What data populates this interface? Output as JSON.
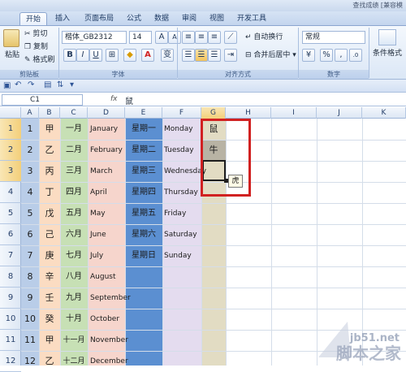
{
  "window": {
    "title": "查找成绩 [兼容模"
  },
  "tabs": [
    "开始",
    "插入",
    "页面布局",
    "公式",
    "数据",
    "审阅",
    "视图",
    "开发工具"
  ],
  "ribbon": {
    "clipboard": {
      "paste": "粘贴",
      "cut": "剪切",
      "copy": "复制",
      "format_painter": "格式刷",
      "label": "剪贴板"
    },
    "font": {
      "name": "楷体_GB2312",
      "size": "14",
      "bold": "B",
      "italic": "I",
      "underline": "U",
      "label": "字体",
      "wen": "变"
    },
    "alignment": {
      "wrap": "自动换行",
      "merge": "合并后居中",
      "label": "对齐方式"
    },
    "number": {
      "format": "常规",
      "percent": "%",
      "comma": ",",
      "label": "数字"
    },
    "styles": {
      "conditional": "条件格式"
    }
  },
  "formula_bar": {
    "name_box": "C1",
    "fx": "fx",
    "content": "鼠"
  },
  "columns": [
    "A",
    "B",
    "C",
    "D",
    "E",
    "F",
    "G",
    "H",
    "I",
    "J",
    "K"
  ],
  "rows": [
    "1",
    "2",
    "3",
    "4",
    "5",
    "6",
    "7",
    "8",
    "9",
    "10",
    "11",
    "12"
  ],
  "col_A": [
    "1",
    "2",
    "3",
    "4",
    "5",
    "6",
    "7",
    "8",
    "9",
    "10",
    "11",
    "12"
  ],
  "col_B": [
    "甲",
    "乙",
    "丙",
    "丁",
    "戊",
    "己",
    "庚",
    "辛",
    "壬",
    "癸",
    "甲",
    "乙"
  ],
  "col_C": [
    "一月",
    "二月",
    "三月",
    "四月",
    "五月",
    "六月",
    "七月",
    "八月",
    "九月",
    "十月",
    "十一月",
    "十二月"
  ],
  "col_D": [
    "January",
    "February",
    "March",
    "April",
    "May",
    "June",
    "July",
    "August",
    "September",
    "October",
    "November",
    "December"
  ],
  "col_E": [
    "星期一",
    "星期二",
    "星期三",
    "星期四",
    "星期五",
    "星期六",
    "星期日"
  ],
  "col_F": [
    "Monday",
    "Tuesday",
    "Wednesday",
    "Thursday",
    "Friday",
    "Saturday",
    "Sunday"
  ],
  "col_G": [
    "鼠",
    "牛"
  ],
  "autofill_tip": "虎",
  "watermark": {
    "url": "jb51.net",
    "cn": "脚本之家"
  },
  "colors": {
    "col_a": "#b9cde8",
    "col_b": "#fbdcc2",
    "col_c": "#c7e0b5",
    "col_d": "#f6d5cc",
    "col_e": "#5b8fd1",
    "col_f": "#e4dcef",
    "col_g": "#e2dcc3",
    "selection": "#d12121"
  }
}
